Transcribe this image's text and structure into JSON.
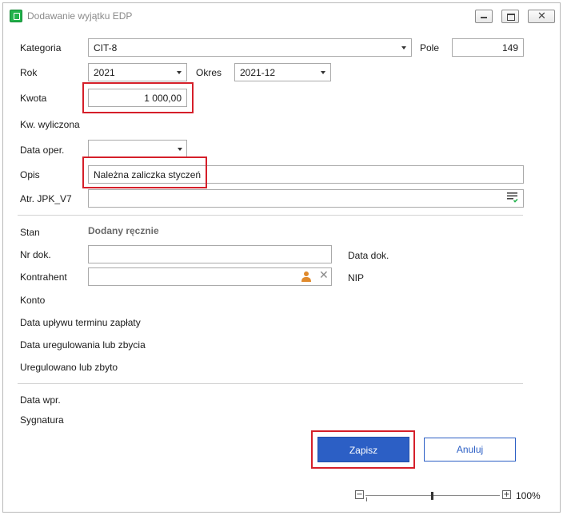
{
  "window": {
    "title": "Dodawanie wyjątku EDP",
    "controls": {
      "minimize": "minimize-icon",
      "maximize": "maximize-icon",
      "close": "✕"
    }
  },
  "form": {
    "kategoria": {
      "label": "Kategoria",
      "value": "CIT-8"
    },
    "pole": {
      "label": "Pole",
      "value": "149"
    },
    "rok": {
      "label": "Rok",
      "value": "2021"
    },
    "okres": {
      "label": "Okres",
      "value": "2021-12"
    },
    "kwota": {
      "label": "Kwota",
      "value": "1 000,00"
    },
    "kw_wyliczona": {
      "label": "Kw. wyliczona"
    },
    "data_oper": {
      "label": "Data oper.",
      "value": ""
    },
    "opis": {
      "label": "Opis",
      "value": "Należna zaliczka styczeń"
    },
    "atr_jpk": {
      "label": "Atr. JPK_V7",
      "value": ""
    },
    "stan": {
      "label": "Stan",
      "value": "Dodany ręcznie"
    },
    "nr_dok": {
      "label": "Nr dok.",
      "value": ""
    },
    "data_dok": {
      "label": "Data dok."
    },
    "kontrahent": {
      "label": "Kontrahent",
      "value": ""
    },
    "nip": {
      "label": "NIP"
    },
    "konto": {
      "label": "Konto"
    },
    "data_uplywu": {
      "label": "Data upływu terminu zapłaty"
    },
    "data_uregulowania": {
      "label": "Data uregulowania lub zbycia"
    },
    "uregulowano": {
      "label": "Uregulowano lub zbyto"
    },
    "data_wpr": {
      "label": "Data wpr."
    },
    "sygnatura": {
      "label": "Sygnatura"
    }
  },
  "buttons": {
    "save": "Zapisz",
    "cancel": "Anuluj"
  },
  "zoom": {
    "value": "100%",
    "minus": "−",
    "plus": "+",
    "level": 0.5
  },
  "colors": {
    "primary": "#2c5fc5",
    "highlight": "#d51f2a",
    "app_icon": "#22b24c"
  }
}
